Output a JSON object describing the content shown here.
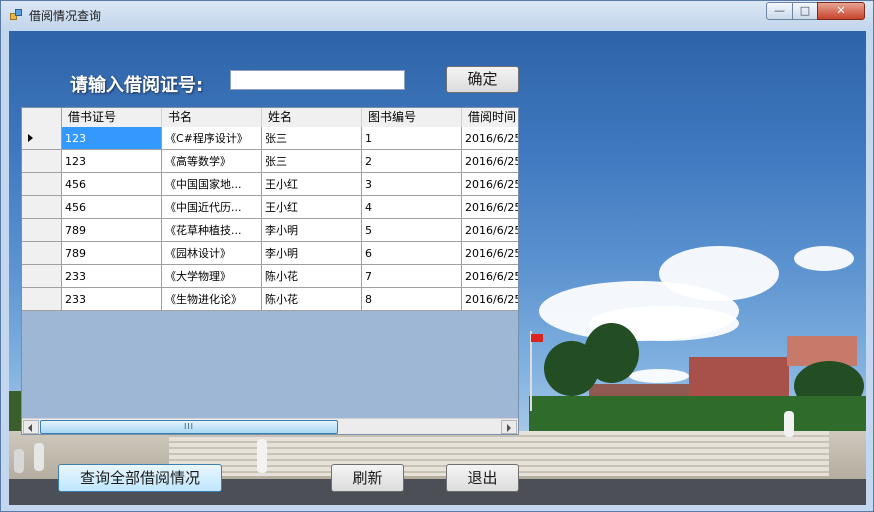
{
  "window": {
    "title": "借阅情况查询",
    "controls": {
      "minimize": "—",
      "maximize": "□",
      "close": "✕"
    }
  },
  "form": {
    "id_label": "请输入借阅证号:",
    "id_input_value": "",
    "confirm_label": "确定"
  },
  "grid": {
    "columns": [
      "借书证号",
      "书名",
      "姓名",
      "图书编号",
      "借阅时间"
    ],
    "selected_row": 0,
    "rows": [
      [
        "123",
        "《C#程序设计》",
        "张三",
        "1",
        "2016/6/25"
      ],
      [
        "123",
        "《高等数学》",
        "张三",
        "2",
        "2016/6/25"
      ],
      [
        "456",
        "《中国国家地...",
        "王小红",
        "3",
        "2016/6/25"
      ],
      [
        "456",
        "《中国近代历...",
        "王小红",
        "4",
        "2016/6/25"
      ],
      [
        "789",
        "《花草种植技...",
        "李小明",
        "5",
        "2016/6/25"
      ],
      [
        "789",
        "《园林设计》",
        "李小明",
        "6",
        "2016/6/25"
      ],
      [
        "233",
        "《大学物理》",
        "陈小花",
        "7",
        "2016/6/25"
      ],
      [
        "233",
        "《生物进化论》",
        "陈小花",
        "8",
        "2016/6/25"
      ]
    ],
    "scroll_thumb_grip": "III"
  },
  "buttons": {
    "query_all": "查询全部借阅情况",
    "refresh": "刷新",
    "exit": "退出"
  }
}
